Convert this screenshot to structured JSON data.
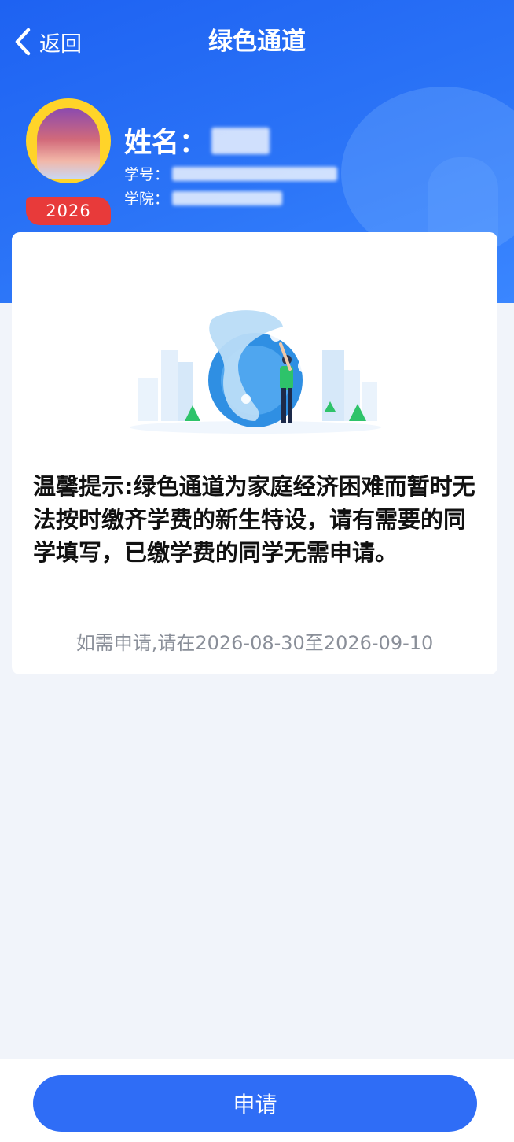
{
  "nav": {
    "back_label": "返回",
    "title": "绿色通道"
  },
  "profile": {
    "name_label": "姓名：",
    "student_id_label": "学号：",
    "college_label": "学院：",
    "year_badge": "2026"
  },
  "card": {
    "notice": "温馨提示:绿色通道为家庭经济困难而暂时无法按时缴齐学费的新生特设，请有需要的同学填写，已缴学费的同学无需申请。",
    "period": "如需申请,请在2026-08-30至2026-09-10"
  },
  "footer": {
    "apply_label": "申请"
  },
  "colors": {
    "header_blue": "#2b74f7",
    "button_blue": "#2f6df6",
    "badge_red": "#e83a3a",
    "avatar_yellow": "#ffd429",
    "page_background": "#f1f4fa"
  },
  "icons": {
    "back": "chevron-left-icon",
    "illustration": "city-person-illustration"
  }
}
